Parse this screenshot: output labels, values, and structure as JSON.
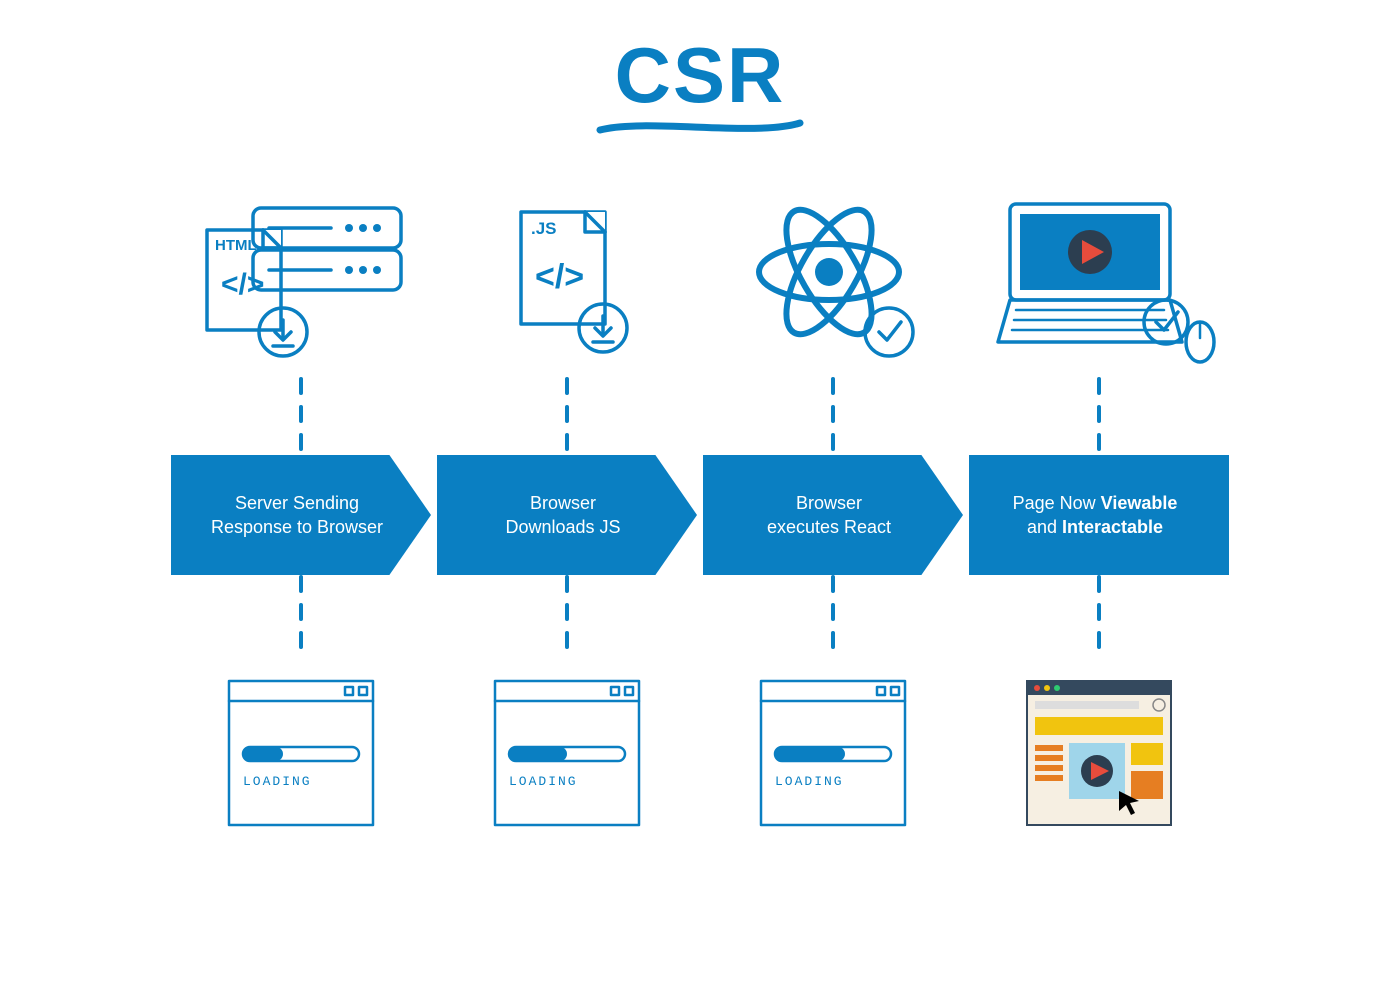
{
  "title": "CSR",
  "stages": [
    {
      "icon": "html-server",
      "icon_label": "HTML",
      "icon_sublabel": "</>",
      "arrow_text_html": "Server Sending<br>Response to Browser",
      "result_icon": "loading",
      "result_text": "LOADING",
      "loading_progress": 0.33
    },
    {
      "icon": "js-file",
      "icon_label": ".JS",
      "icon_sublabel": "</>",
      "arrow_text_html": "Browser<br>Downloads JS",
      "result_icon": "loading",
      "result_text": "LOADING",
      "loading_progress": 0.5
    },
    {
      "icon": "react-check",
      "icon_label": "",
      "icon_sublabel": "",
      "arrow_text_html": "Browser<br>executes React",
      "result_icon": "loading",
      "result_text": "LOADING",
      "loading_progress": 0.6
    },
    {
      "icon": "laptop-ready",
      "icon_label": "",
      "icon_sublabel": "",
      "arrow_text_html": "Page Now <b>Viewable</b><br>and <b>Interactable</b>",
      "result_icon": "rendered-page",
      "result_text": "",
      "loading_progress": 1.0
    }
  ]
}
